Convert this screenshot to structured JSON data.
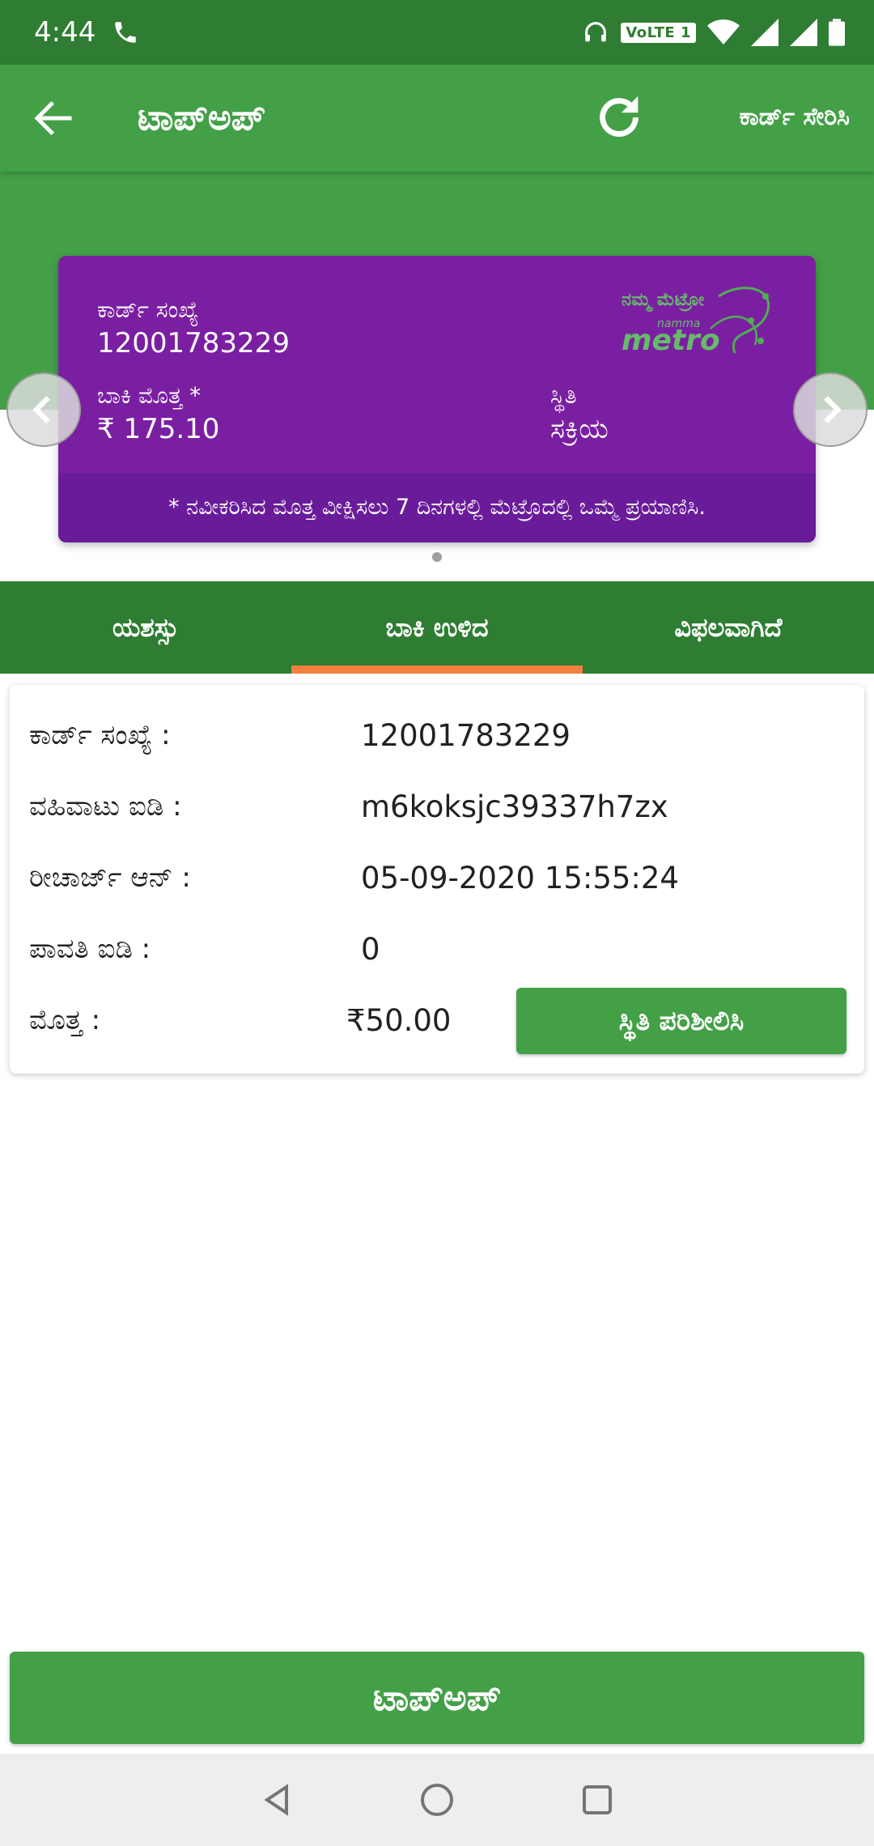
{
  "status_bar": {
    "time": "4:44",
    "volte": "VoLTE 1",
    "icons": [
      "phone-icon",
      "headphones-icon",
      "wifi-icon",
      "signal-icon",
      "battery-icon"
    ]
  },
  "app_bar": {
    "title": "ಟಾಪ್‌ಅಪ್",
    "card_series": "ಕಾರ್ಡ್ ಸೇರಿಸಿ"
  },
  "card": {
    "number_label": "ಕಾರ್ಡ್ ಸಂಖ್ಯೆ",
    "number": "12001783229",
    "balance_label": "ಬಾಕಿ ಮೊತ್ತ *",
    "balance": "₹ 175.10",
    "status_label": "ಸ್ಥಿತಿ",
    "status": "ಸಕ್ರಿಯ",
    "footer_note": "* ನವೀಕರಿಸಿದ ಮೊತ್ತ ವೀಕ್ಷಿಸಲು 7 ದಿನಗಳಲ್ಲಿ ಮೆಟ್ರೊದಲ್ಲಿ ಒಮ್ಮೆ ಪ್ರಯಾಣಿಸಿ.",
    "logo_kn": "ನಮ್ಮ ಮೆಟ್ರೋ",
    "logo_en_small": "namma",
    "logo_en": "metro",
    "brand_color": "#7b1fa2"
  },
  "tabs": [
    {
      "label": "ಯಶಸ್ಸು",
      "active": false
    },
    {
      "label": "ಬಾಕಿ ಉಳಿದ",
      "active": true
    },
    {
      "label": "ವಿಫಲವಾಗಿದೆ",
      "active": false
    }
  ],
  "details": {
    "card_number_label": "ಕಾರ್ಡ್ ಸಂಖ್ಯೆ :",
    "card_number": "12001783229",
    "txn_id_label": "ವಹಿವಾಟು ಐಡಿ :",
    "txn_id": "m6koksjc39337h7zx",
    "recharge_on_label": "ರೀಚಾರ್ಜ್ ಆನ್ :",
    "recharge_on": "05-09-2020 15:55:24",
    "receipt_id_label": "ಪಾವತಿ ಐಡಿ :",
    "receipt_id": "0",
    "amount_label": "ಮೊತ್ತ :",
    "amount": "₹50.00",
    "check_status_label": "ಸ್ಥಿತಿ ಪರಿಶೀಲಿಸಿ"
  },
  "bottom": {
    "topup_label": "ಟಾಪ್‌ಅಪ್"
  },
  "colors": {
    "primary": "#43a047",
    "dark_primary": "#2e7d32",
    "accent": "#f4813f"
  }
}
